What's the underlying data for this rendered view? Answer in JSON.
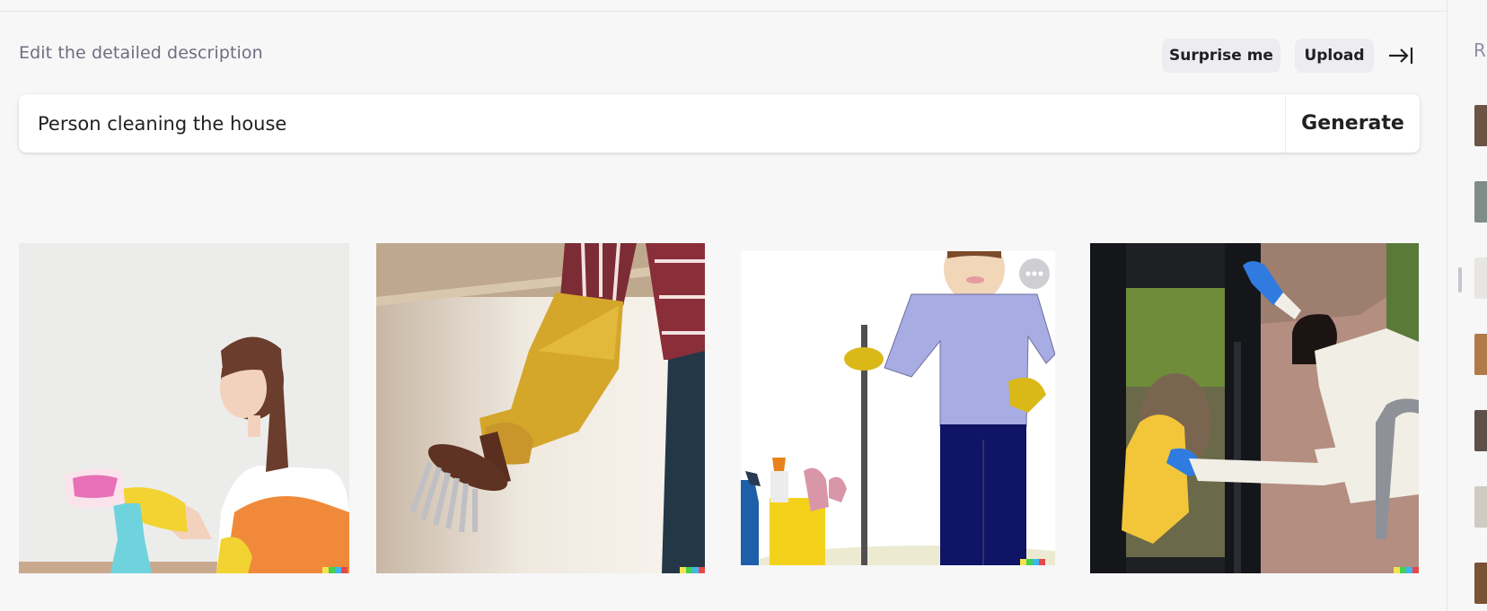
{
  "header": {
    "subtitle": "Edit the detailed description",
    "surprise_label": "Surprise me",
    "upload_label": "Upload",
    "collapse_icon": "collapse-right-icon"
  },
  "prompt": {
    "value": "Person cleaning the house",
    "generate_label": "Generate"
  },
  "results": [
    {
      "name": "result-image-woman-spraying-wall"
    },
    {
      "name": "result-image-glove-scrub-brush"
    },
    {
      "name": "result-image-cartoon-mop"
    },
    {
      "name": "result-image-man-wiping-door"
    }
  ],
  "more_icon": "more-horizontal-icon",
  "history_panel": {
    "heading_letter": "R",
    "thumbnail_count": 8
  },
  "colors": {
    "background": "#f7f7f8",
    "button_bg": "#ececf1",
    "subtitle_text": "#6e6e80",
    "text": "#202123"
  }
}
